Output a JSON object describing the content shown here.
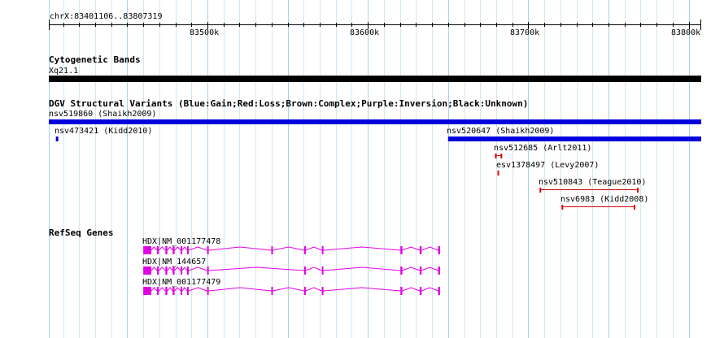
{
  "ruler": {
    "location": "chrX:83401106..83807319",
    "start": 83401106,
    "end": 83807319,
    "ticks": [
      {
        "pos": 83500000,
        "label": "83500k"
      },
      {
        "pos": 83600000,
        "label": "83600k"
      },
      {
        "pos": 83700000,
        "label": "83700k"
      },
      {
        "pos": 83800000,
        "label": "83800k"
      }
    ]
  },
  "tracks": {
    "cytobands": {
      "title": "Cytogenetic Bands",
      "band": {
        "name": "Xq21.1",
        "start": 83401106,
        "end": 83807319,
        "color": "#000000"
      }
    },
    "dgv": {
      "title": "DGV Structural Variants (Blue:Gain;Red:Loss;Brown:Complex;Purple:Inversion;Black:Unknown)",
      "colors": {
        "gain": "#0000dd",
        "loss": "#dd0000"
      },
      "variants": [
        {
          "label": "nsv519860 (Shaikh2009)",
          "start": 83401106,
          "end": 83807319,
          "type": "gain",
          "row": 0
        },
        {
          "label": "nsv473421 (Kidd2010)",
          "start": 83405500,
          "end": 83406500,
          "type": "gain",
          "row": 1
        },
        {
          "label": "nsv520647 (Shaikh2009)",
          "start": 83650000,
          "end": 83807319,
          "type": "gain",
          "row": 1
        },
        {
          "label": "nsv512685 (Arlt2011)",
          "start": 83679500,
          "end": 83683500,
          "type": "loss",
          "row": 2
        },
        {
          "label": "esv1378497 (Levy2007)",
          "start": 83680800,
          "end": 83681600,
          "type": "loss",
          "row": 3
        },
        {
          "label": "nsv510843 (Teague2010)",
          "start": 83707300,
          "end": 83768500,
          "type": "loss",
          "row": 4
        },
        {
          "label": "nsv6983 (Kidd2008)",
          "start": 83721000,
          "end": 83766500,
          "type": "loss",
          "row": 5
        }
      ]
    },
    "refseq": {
      "title": "RefSeq Genes",
      "color": "#e400e4",
      "tx_start": 83460000,
      "tx_end": 83645000,
      "transcripts": [
        {
          "label": "HDX|NM_001177478",
          "exons": [
            [
              83460000,
              83465000
            ],
            [
              83468500,
              83469700
            ],
            [
              83473800,
              83475000
            ],
            [
              83478300,
              83479500
            ],
            [
              83483300,
              83484300
            ],
            [
              83487300,
              83488300
            ],
            [
              83499800,
              83500800
            ],
            [
              83539800,
              83540800
            ],
            [
              83560300,
              83561300
            ],
            [
              83571300,
              83572300
            ],
            [
              83620300,
              83621500
            ],
            [
              83632300,
              83633500
            ],
            [
              83643800,
              83645000
            ]
          ]
        },
        {
          "label": "HDX|NM_144657",
          "exons": [
            [
              83460000,
              83465000
            ],
            [
              83468500,
              83469700
            ],
            [
              83473800,
              83475000
            ],
            [
              83478300,
              83479500
            ],
            [
              83483300,
              83484300
            ],
            [
              83487300,
              83488300
            ],
            [
              83499800,
              83500800
            ],
            [
              83560300,
              83561300
            ],
            [
              83571300,
              83572300
            ],
            [
              83620300,
              83621500
            ],
            [
              83632300,
              83633500
            ],
            [
              83643800,
              83645000
            ]
          ]
        },
        {
          "label": "HDX|NM_001177479",
          "exons": [
            [
              83460000,
              83465000
            ],
            [
              83468500,
              83469700
            ],
            [
              83473800,
              83475000
            ],
            [
              83478300,
              83479500
            ],
            [
              83483300,
              83484300
            ],
            [
              83487300,
              83488300
            ],
            [
              83499800,
              83500800
            ],
            [
              83539800,
              83540800
            ],
            [
              83560300,
              83561300
            ],
            [
              83571300,
              83572300
            ],
            [
              83620300,
              83621500
            ],
            [
              83632300,
              83633500
            ],
            [
              83643800,
              83645000
            ]
          ]
        }
      ]
    }
  }
}
